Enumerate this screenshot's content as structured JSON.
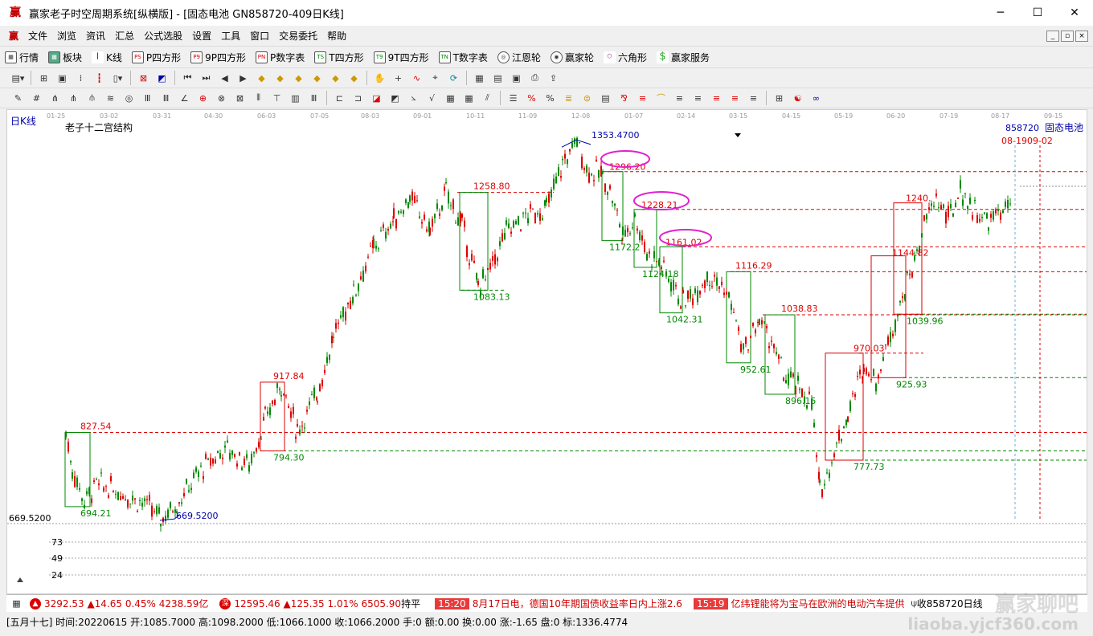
{
  "window": {
    "title": "赢家老子时空周期系统[纵横版] - [固态电池  GN858720-409日K线]",
    "logo_char": "赢",
    "minimize": "─",
    "maximize": "☐",
    "close": "✕"
  },
  "menu": [
    "文件",
    "浏览",
    "资讯",
    "汇总",
    "公式选股",
    "设置",
    "工具",
    "窗口",
    "交易委托",
    "帮助"
  ],
  "toolbar1": [
    {
      "icon": "grid-icon",
      "label": "行情"
    },
    {
      "icon": "blocks-icon",
      "label": "板块"
    },
    {
      "icon": "candle-icon",
      "label": "K线"
    },
    {
      "icon": "ps-icon",
      "label": "P四方形"
    },
    {
      "icon": "p9-icon",
      "label": "9P四方形"
    },
    {
      "icon": "pn-icon",
      "label": "P数字表"
    },
    {
      "icon": "ts-icon",
      "label": "T四方形"
    },
    {
      "icon": "t9-icon",
      "label": "9T四方形"
    },
    {
      "icon": "tn-icon",
      "label": "T数字表"
    },
    {
      "icon": "gann-wheel-icon",
      "label": "江恩轮"
    },
    {
      "icon": "winner-wheel-icon",
      "label": "赢家轮"
    },
    {
      "icon": "hexagon-icon",
      "label": "六角形"
    },
    {
      "icon": "dollar-icon",
      "label": "赢家服务"
    }
  ],
  "chart": {
    "period_label": "日K线",
    "indicator_label": "老子十二宫结构",
    "code_label": "858720",
    "name_label": "固态电池",
    "date_tag": "08-1909-02",
    "y_axis_low": "669.5200",
    "sub_ticks": [
      "73",
      "49",
      "24"
    ],
    "dates": [
      "01-25",
      "03-02",
      "03-31",
      "04-30",
      "06-03",
      "07-05",
      "08-03",
      "09-01",
      "10-11",
      "11-09",
      "12-08",
      "01-07",
      "02-14",
      "03-15",
      "04-15",
      "05-19",
      "06-20",
      "07-19",
      "08-17",
      "09-15"
    ],
    "labels": {
      "high": "1353.4700",
      "low": "669.5200",
      "l1296": "1296.20",
      "l1258": "1258.80",
      "l1228": "1228.21",
      "l1161": "1161.02",
      "l1172": "1172.2",
      "l1124": "1124.18",
      "l1116": "1116.29",
      "l1083": "1083.13",
      "l1042": "1042.31",
      "l1038": "1038.83",
      "l1039": "1039.96",
      "l970": "970.03",
      "l952": "952.61",
      "l925": "925.93",
      "l917": "917.84",
      "l896": "896.15",
      "l827": "827.54",
      "l794": "794.30",
      "l777": "777.73",
      "l694": "694.21",
      "l1240": "1240.",
      "l1144": "1144.82"
    }
  },
  "chart_data": {
    "type": "candlestick",
    "title": "老子十二宫结构",
    "x_ticks": [
      "01-25",
      "03-02",
      "03-31",
      "04-30",
      "06-03",
      "07-05",
      "08-03",
      "09-01",
      "10-11",
      "11-09",
      "12-08",
      "01-07",
      "02-14",
      "03-15",
      "04-15",
      "05-19",
      "06-20",
      "07-19",
      "08-17",
      "09-15"
    ],
    "ylim": [
      669.52,
      1353.47
    ],
    "swing_points": [
      {
        "date": "01-25",
        "value": 827.54
      },
      {
        "date": "03-31",
        "value": 669.52
      },
      {
        "date": "06-03",
        "value": 917.84
      },
      {
        "date": "06-03",
        "value": 794.3
      },
      {
        "date": "09-01",
        "value": 1258.8
      },
      {
        "date": "10-11",
        "value": 1083.13
      },
      {
        "date": "12-08",
        "value": 1353.47
      },
      {
        "date": "01-07",
        "value": 1296.2
      },
      {
        "date": "01-07",
        "value": 1228.21
      },
      {
        "date": "02-14",
        "value": 1161.02
      },
      {
        "date": "02-14",
        "value": 1042.31
      },
      {
        "date": "03-15",
        "value": 1116.29
      },
      {
        "date": "03-15",
        "value": 952.61
      },
      {
        "date": "04-15",
        "value": 1038.83
      },
      {
        "date": "04-15",
        "value": 896.15
      },
      {
        "date": "05-19",
        "value": 777.73
      },
      {
        "date": "05-19",
        "value": 970.03
      },
      {
        "date": "06-20",
        "value": 1144.82
      },
      {
        "date": "06-20",
        "value": 925.93
      },
      {
        "date": "06-20",
        "value": 1039.96
      },
      {
        "date": "07-19",
        "value": 1240.0
      }
    ]
  },
  "status": {
    "idx1": "3292.53 ▲14.65 0.45% 4238.59亿",
    "idx2": "12595.46 ▲125.35 1.01% 6505.90",
    "idx2_suffix": "持平",
    "news1_time": "15:20",
    "news1": "8月17日电，德国10年期国债收益率日内上涨2.6",
    "news2_time": "15:19",
    "news2": "亿纬锂能将为宝马在欧洲的电动汽车提供",
    "right": "收858720日线"
  },
  "info": "[五月十七] 时间:20220615 开:1085.7000 高:1098.2000 低:1066.1000 收:1066.2000 手:0 额:0.00 换:0.00 涨:-1.65 盘:0 标:1336.4774",
  "watermark": {
    "line1": "赢家聊吧",
    "line2": "liaoba.yjcf360.com"
  }
}
